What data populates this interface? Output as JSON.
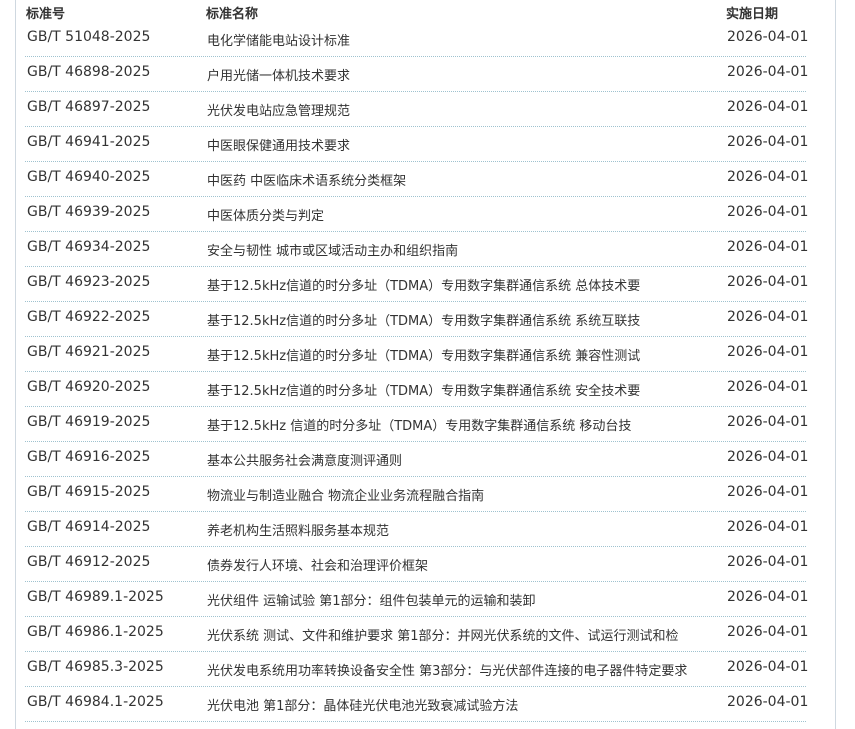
{
  "header": {
    "code": "标准号",
    "name": "标准名称",
    "date": "实施日期"
  },
  "rows": [
    {
      "code": "GB/T 51048-2025",
      "name": "电化学储能电站设计标准",
      "date": "2026-04-01"
    },
    {
      "code": "GB/T 46898-2025",
      "name": "户用光储一体机技术要求",
      "date": "2026-04-01"
    },
    {
      "code": "GB/T 46897-2025",
      "name": "光伏发电站应急管理规范",
      "date": "2026-04-01"
    },
    {
      "code": "GB/T 46941-2025",
      "name": "中医眼保健通用技术要求",
      "date": "2026-04-01"
    },
    {
      "code": "GB/T 46940-2025",
      "name": "中医药 中医临床术语系统分类框架",
      "date": "2026-04-01"
    },
    {
      "code": "GB/T 46939-2025",
      "name": "中医体质分类与判定",
      "date": "2026-04-01"
    },
    {
      "code": "GB/T 46934-2025",
      "name": "安全与韧性 城市或区域活动主办和组织指南",
      "date": "2026-04-01"
    },
    {
      "code": "GB/T 46923-2025",
      "name": "基于12.5kHz信道的时分多址（TDMA）专用数字集群通信系统 总体技术要",
      "date": "2026-04-01"
    },
    {
      "code": "GB/T 46922-2025",
      "name": "基于12.5kHz信道的时分多址（TDMA）专用数字集群通信系统 系统互联技",
      "date": "2026-04-01"
    },
    {
      "code": "GB/T 46921-2025",
      "name": "基于12.5kHz信道的时分多址（TDMA）专用数字集群通信系统 兼容性测试",
      "date": "2026-04-01"
    },
    {
      "code": "GB/T 46920-2025",
      "name": "基于12.5kHz信道的时分多址（TDMA）专用数字集群通信系统 安全技术要",
      "date": "2026-04-01"
    },
    {
      "code": "GB/T 46919-2025",
      "name": "基于12.5kHz 信道的时分多址（TDMA）专用数字集群通信系统 移动台技",
      "date": "2026-04-01"
    },
    {
      "code": "GB/T 46916-2025",
      "name": "基本公共服务社会满意度测评通则",
      "date": "2026-04-01"
    },
    {
      "code": "GB/T 46915-2025",
      "name": "物流业与制造业融合 物流企业业务流程融合指南",
      "date": "2026-04-01"
    },
    {
      "code": "GB/T 46914-2025",
      "name": "养老机构生活照料服务基本规范",
      "date": "2026-04-01"
    },
    {
      "code": "GB/T 46912-2025",
      "name": "债券发行人环境、社会和治理评价框架",
      "date": "2026-04-01"
    },
    {
      "code": "GB/T 46989.1-2025",
      "name": "光伏组件 运输试验 第1部分：组件包装单元的运输和装卸",
      "date": "2026-04-01"
    },
    {
      "code": "GB/T 46986.1-2025",
      "name": "光伏系统 测试、文件和维护要求 第1部分：并网光伏系统的文件、试运行测试和检",
      "date": "2026-04-01"
    },
    {
      "code": "GB/T 46985.3-2025",
      "name": "光伏发电系统用功率转换设备安全性 第3部分：与光伏部件连接的电子器件特定要求",
      "date": "2026-04-01"
    },
    {
      "code": "GB/T 46984.1-2025",
      "name": "光伏电池 第1部分：晶体硅光伏电池光致衰减试验方法",
      "date": "2026-04-01"
    }
  ]
}
